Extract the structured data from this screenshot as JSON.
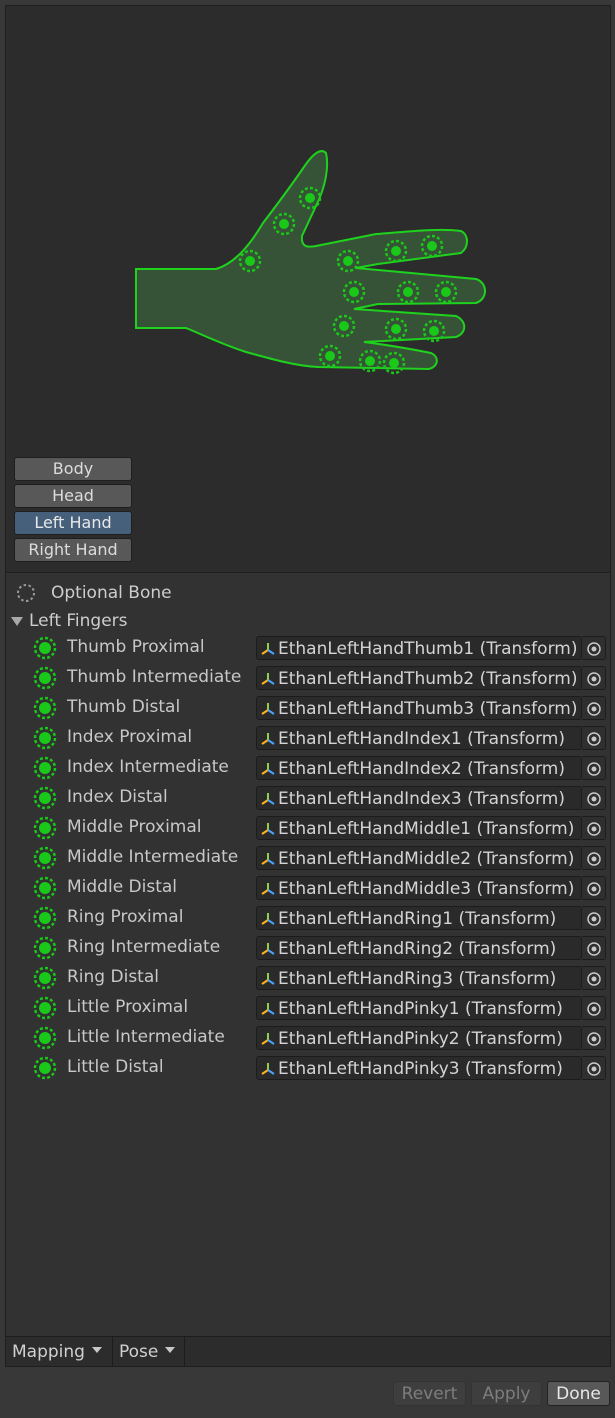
{
  "body_parts": [
    {
      "label": "Body",
      "active": false
    },
    {
      "label": "Head",
      "active": false
    },
    {
      "label": "Left Hand",
      "active": true
    },
    {
      "label": "Right Hand",
      "active": false
    }
  ],
  "legend": {
    "optional_bone_label": "Optional Bone"
  },
  "foldout": {
    "label": "Left Fingers",
    "expanded": true
  },
  "bones": [
    {
      "name": "Thumb Proximal",
      "value": "EthanLeftHandThumb1 (Transform)"
    },
    {
      "name": "Thumb Intermediate",
      "value": "EthanLeftHandThumb2 (Transform)"
    },
    {
      "name": "Thumb Distal",
      "value": "EthanLeftHandThumb3 (Transform)"
    },
    {
      "name": "Index Proximal",
      "value": "EthanLeftHandIndex1 (Transform)"
    },
    {
      "name": "Index Intermediate",
      "value": "EthanLeftHandIndex2 (Transform)"
    },
    {
      "name": "Index Distal",
      "value": "EthanLeftHandIndex3 (Transform)"
    },
    {
      "name": "Middle Proximal",
      "value": "EthanLeftHandMiddle1 (Transform)"
    },
    {
      "name": "Middle Intermediate",
      "value": "EthanLeftHandMiddle2 (Transform)"
    },
    {
      "name": "Middle Distal",
      "value": "EthanLeftHandMiddle3 (Transform)"
    },
    {
      "name": "Ring Proximal",
      "value": "EthanLeftHandRing1 (Transform)"
    },
    {
      "name": "Ring Intermediate",
      "value": "EthanLeftHandRing2 (Transform)"
    },
    {
      "name": "Ring Distal",
      "value": "EthanLeftHandRing3 (Transform)"
    },
    {
      "name": "Little Proximal",
      "value": "EthanLeftHandPinky1 (Transform)"
    },
    {
      "name": "Little Intermediate",
      "value": "EthanLeftHandPinky2 (Transform)"
    },
    {
      "name": "Little Distal",
      "value": "EthanLeftHandPinky3 (Transform)"
    }
  ],
  "bottom_tabs": {
    "mapping": "Mapping",
    "pose": "Pose"
  },
  "actions": {
    "revert": "Revert",
    "apply": "Apply",
    "done": "Done"
  },
  "colors": {
    "bone_green": "#19c819",
    "hand_fill": "#3a5a3a",
    "hand_outline": "#1ed21e",
    "active_button": "#46607c"
  },
  "icons": {
    "bone_status": "bone-mapped-icon",
    "transform": "transform-icon",
    "picker": "object-picker-icon",
    "optional": "optional-bone-icon"
  }
}
